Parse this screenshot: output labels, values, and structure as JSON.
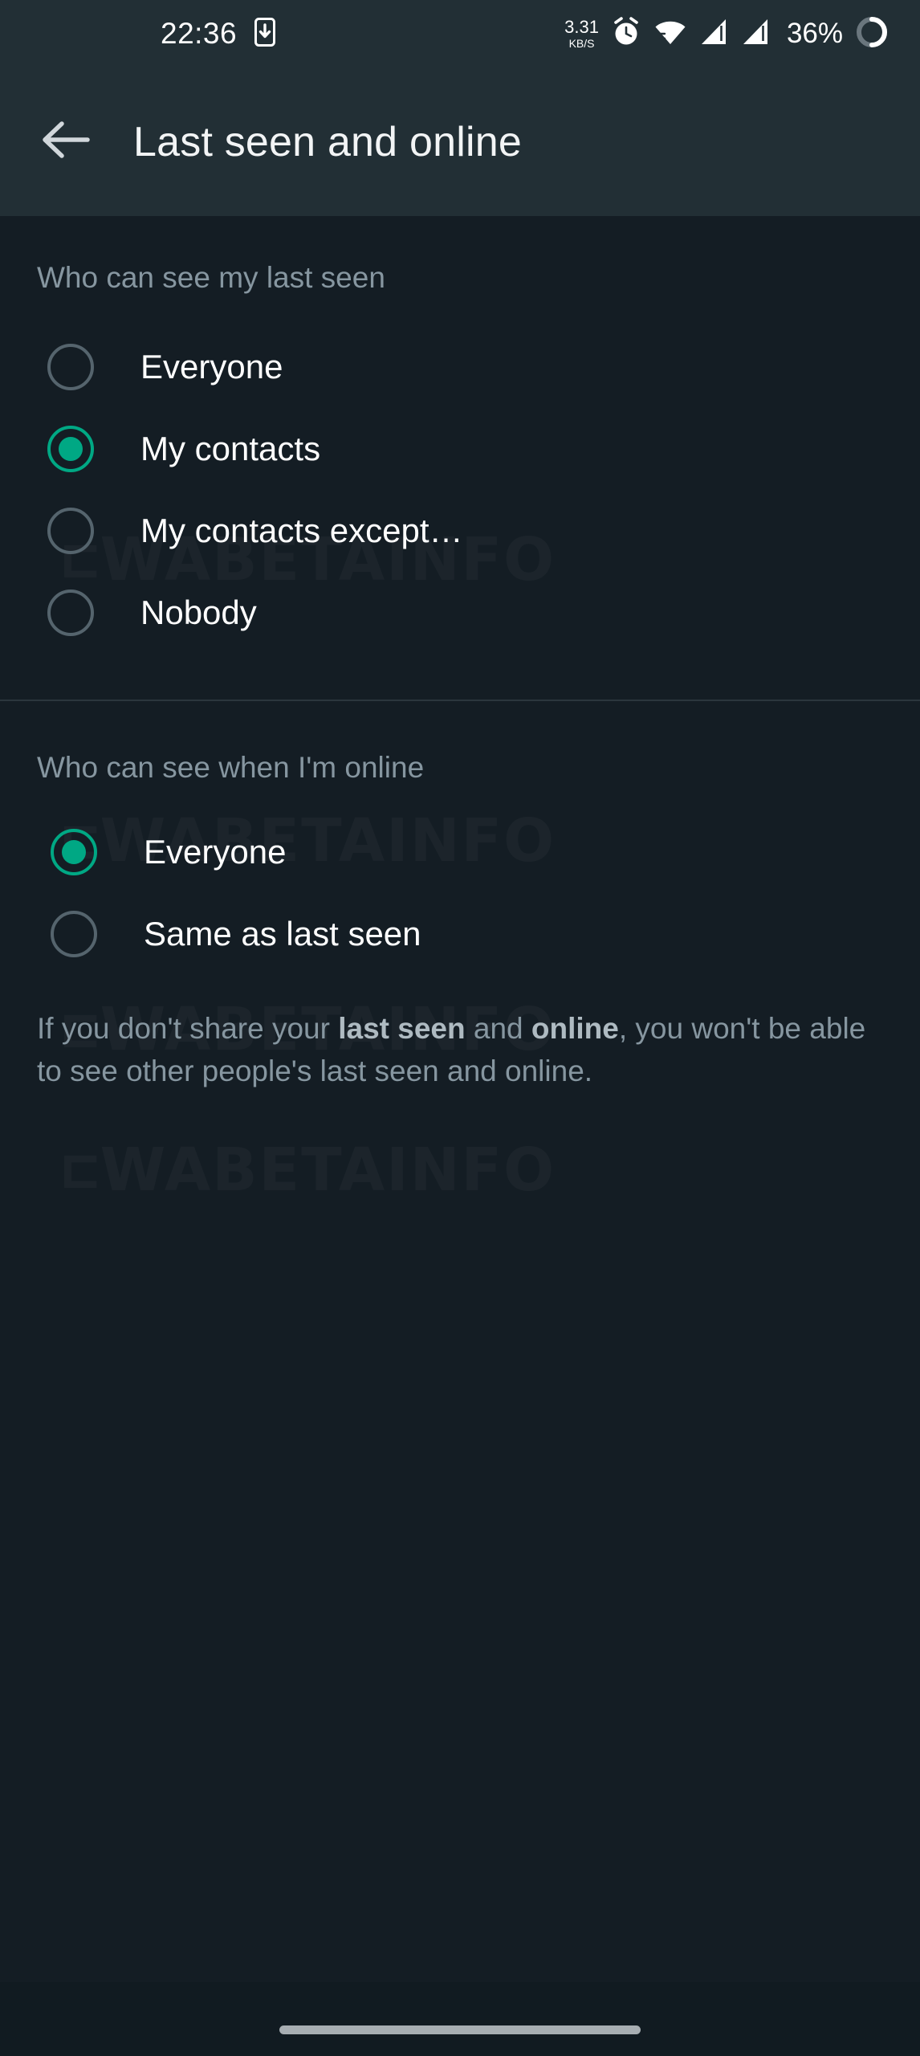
{
  "status_bar": {
    "time": "22:36",
    "net_speed_value": "3.31",
    "net_speed_unit": "KB/S",
    "battery_percent": "36%",
    "icons": [
      "sim-card-download-icon",
      "alarm-clock-icon",
      "wifi-icon",
      "signal-bars-icon",
      "signal-bars-2-icon",
      "battery-circle-icon"
    ]
  },
  "appbar": {
    "back_icon": "arrow-left-icon",
    "title": "Last seen and online"
  },
  "watermark": {
    "text": "WABETAINFO",
    "logo_glyph": "⊏",
    "color": "#ffffff"
  },
  "sections": [
    {
      "header": "Who can see my last seen",
      "options": [
        {
          "label": "Everyone",
          "selected": false
        },
        {
          "label": "My contacts",
          "selected": true
        },
        {
          "label": "My contacts except…",
          "selected": false
        },
        {
          "label": "Nobody",
          "selected": false
        }
      ]
    },
    {
      "header": "Who can see when I'm online",
      "options": [
        {
          "label": "Everyone",
          "selected": true
        },
        {
          "label": "Same as last seen",
          "selected": false
        }
      ]
    }
  ],
  "footnote": {
    "part1": "If you don't share your ",
    "bold1": "last seen",
    "part2": " and ",
    "bold2": "online",
    "part3": ", you won't be able to see other people's last seen and online."
  },
  "colors": {
    "accent": "#00a884",
    "appbar_bg": "#222f35",
    "page_bg": "#141d24",
    "secondary_text": "#8696a0",
    "primary_text": "#ffffff",
    "radio_unselected": "#55646d"
  },
  "nav_bar": {
    "gesture_pill": "home-gesture-pill"
  }
}
